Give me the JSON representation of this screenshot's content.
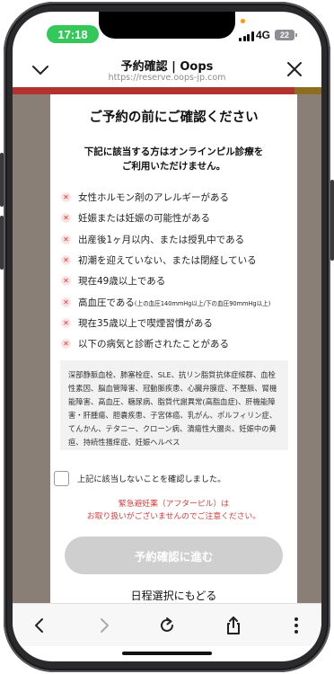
{
  "status_bar": {
    "time": "17:18",
    "network": "4G",
    "battery": "22"
  },
  "browser": {
    "title": "予約確認 | Oops",
    "url": "https://reserve.oops-jp.com"
  },
  "modal": {
    "title": "ご予約の前にご確認ください",
    "lead_line1": "下記に該当する方はオンラインピル診療を",
    "lead_line2": "ご利用いただけません。",
    "conditions": [
      {
        "text": "女性ホルモン剤のアレルギーがある",
        "note": ""
      },
      {
        "text": "妊娠または妊娠の可能性がある",
        "note": ""
      },
      {
        "text": "出産後1ヶ月以内、または授乳中である",
        "note": ""
      },
      {
        "text": "初潮を迎えていない、または閉経している",
        "note": ""
      },
      {
        "text": "現在49歳以上である",
        "note": ""
      },
      {
        "text": "高血圧である",
        "note": "(上の血圧140mmHg以上/下の血圧90mmHg以上)"
      },
      {
        "text": "現在35歳以上で喫煙習慣がある",
        "note": ""
      },
      {
        "text": "以下の病気と診断されたことがある",
        "note": ""
      }
    ],
    "diseases": "深部静脈血栓、肺塞栓症、SLE、抗リン脂質抗体症候群、血栓性素因、脳血管障害、冠動脈疾患、心臓弁膜症、不整脈、腎機能障害、高血圧、糖尿病、脂質代謝異常(高脂血症)、肝機能障害・肝腫瘍、胆嚢疾患、子宮体癌、乳がん、ポルフィリン症、てんかん、テタニー、クローン病、潰瘍性大腸炎、妊娠中の黄疸、持続性掻痒症、妊娠ヘルペス",
    "confirm_label": "上記に該当しないことを確認しました。",
    "warn_line1": "緊急避妊薬（アフターピル）は",
    "warn_line2": "お取り扱いがございませんのでご注意ください。",
    "proceed_label": "予約確認に進む",
    "back_label": "日程選択にもどる"
  },
  "colors": {
    "accent_red": "#d93a3a",
    "status_green": "#34c759",
    "disabled_button": "#cfcfcf",
    "overlay": "#8a7f77"
  },
  "icons": {
    "header_left": "chevron-down-icon",
    "header_right": "close-icon",
    "toolbar": [
      "back-icon",
      "forward-icon",
      "reload-icon",
      "share-icon",
      "more-icon"
    ]
  }
}
